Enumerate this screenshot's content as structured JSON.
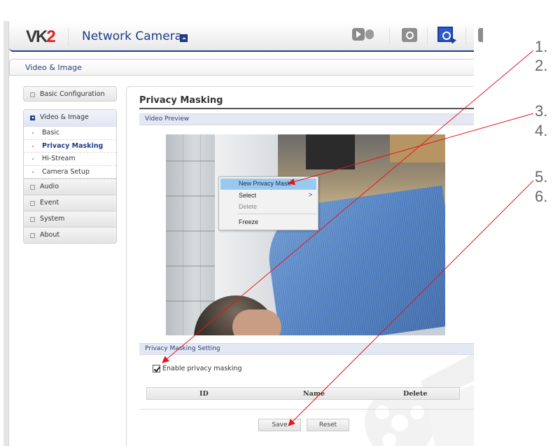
{
  "header": {
    "logo_main": "VK",
    "logo_accent": "2",
    "app_title": "Network Camera",
    "toolbar": [
      {
        "icon": "live-view-icon",
        "label": "Live View"
      },
      {
        "icon": "search-icon",
        "label": "Search"
      },
      {
        "icon": "setup-icon",
        "label": "Setup",
        "active": true
      },
      {
        "icon": "more-icon",
        "label": "More"
      }
    ]
  },
  "breadcrumb": "Video & Image",
  "sidebar": {
    "basic_configuration": "Basic Configuration",
    "video_image": {
      "label": "Video & Image",
      "items": [
        "Basic",
        "Privacy Masking",
        "Hi-Stream",
        "Camera Setup"
      ],
      "current": "Privacy Masking"
    },
    "items": [
      "Audio",
      "Event",
      "System",
      "About"
    ]
  },
  "main": {
    "title": "Privacy Masking",
    "video_section": "Video Preview",
    "context_menu": {
      "items": [
        {
          "label": "New Privacy Mask",
          "highlighted": true
        },
        {
          "label": "Select",
          "submenu": true,
          "arrow": ">"
        },
        {
          "label": "Delete",
          "disabled": true
        },
        {
          "label": "Freeze"
        }
      ]
    },
    "setting_section": "Privacy Masking Setting",
    "enable_label": "Enable privacy masking",
    "enable_checked": true,
    "table_headers": [
      "ID",
      "Name",
      "Delete"
    ],
    "save_label": "Save",
    "reset_label": "Reset"
  },
  "annotations": {
    "numbers": [
      "1.",
      "2.",
      "3.",
      "4.",
      "5.",
      "6."
    ],
    "arrow_color": "#e8141e"
  },
  "colors": {
    "brand_blue": "#1f3c88",
    "logo_red": "#e02020",
    "menu_highlight": "#99c9ef",
    "section_bar": "#e3e8f3"
  }
}
